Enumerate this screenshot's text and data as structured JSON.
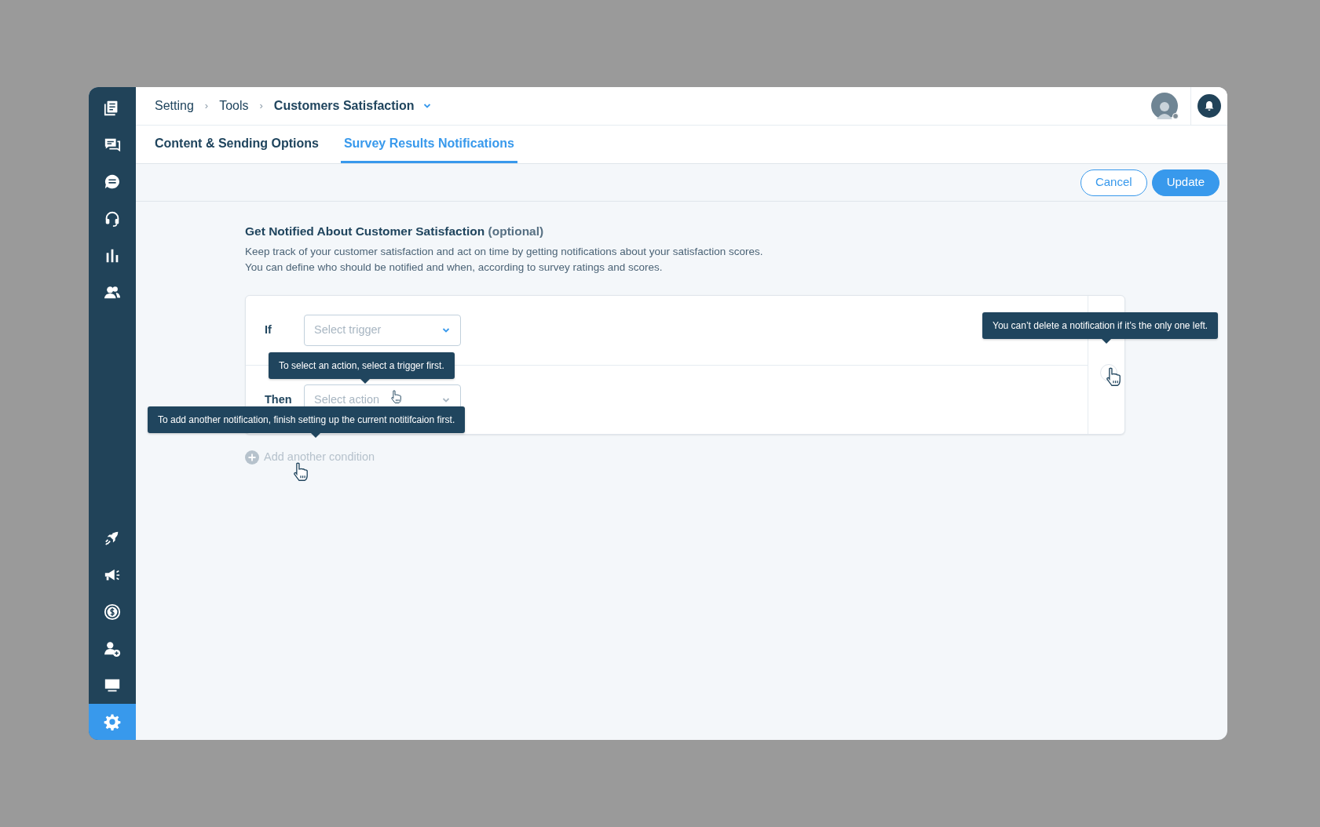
{
  "sidebar": {
    "top_items": [
      {
        "kind": "book",
        "selected": false
      },
      {
        "kind": "chat",
        "selected": false
      },
      {
        "kind": "bubble",
        "selected": false
      },
      {
        "kind": "headset",
        "selected": false
      },
      {
        "kind": "chart",
        "selected": false
      },
      {
        "kind": "people",
        "selected": false
      }
    ],
    "bottom_items": [
      {
        "kind": "rocket",
        "selected": false
      },
      {
        "kind": "megaphone",
        "selected": false
      },
      {
        "kind": "dollar",
        "selected": false
      },
      {
        "kind": "adduser",
        "selected": false
      },
      {
        "kind": "monitor",
        "selected": false
      },
      {
        "kind": "gear",
        "selected": true
      }
    ]
  },
  "breadcrumb": [
    {
      "label": "Setting",
      "current": false
    },
    {
      "separator": "›",
      "label": "Tools",
      "current": false
    },
    {
      "separator": "›",
      "label": "Customers Satisfaction",
      "current": true
    }
  ],
  "tabs": [
    {
      "label": "Content & Sending Options",
      "selected": false
    },
    {
      "label": "Survey Results Notifications",
      "selected": true
    }
  ],
  "buttons": [
    {
      "label": "Cancel",
      "kind": "outline"
    },
    {
      "label": "Update",
      "kind": "primary"
    }
  ],
  "section": {
    "title": "Get Notified About Customer Satisfaction",
    "note": "(optional)",
    "description": [
      "Keep track of your customer satisfaction and act on time by getting notifications about your satisfaction scores.",
      "You can define who should be notified and when, according to survey ratings and scores."
    ]
  },
  "rules": [
    {
      "label": "If",
      "placeholder": "Select trigger",
      "disabled": false
    },
    {
      "label": "Then",
      "placeholder": "Select action",
      "disabled": true
    }
  ],
  "add_condition": {
    "label": "Add another condition",
    "disabled": true
  },
  "tooltips": [
    {
      "text": "You can’t delete a notification if it’s the only one left.",
      "kind": "delete"
    },
    {
      "text": "To select an action, select a trigger first.",
      "kind": "action"
    },
    {
      "text": "To add another notification, finish setting up the current notitifcaion first.",
      "kind": "add"
    }
  ]
}
